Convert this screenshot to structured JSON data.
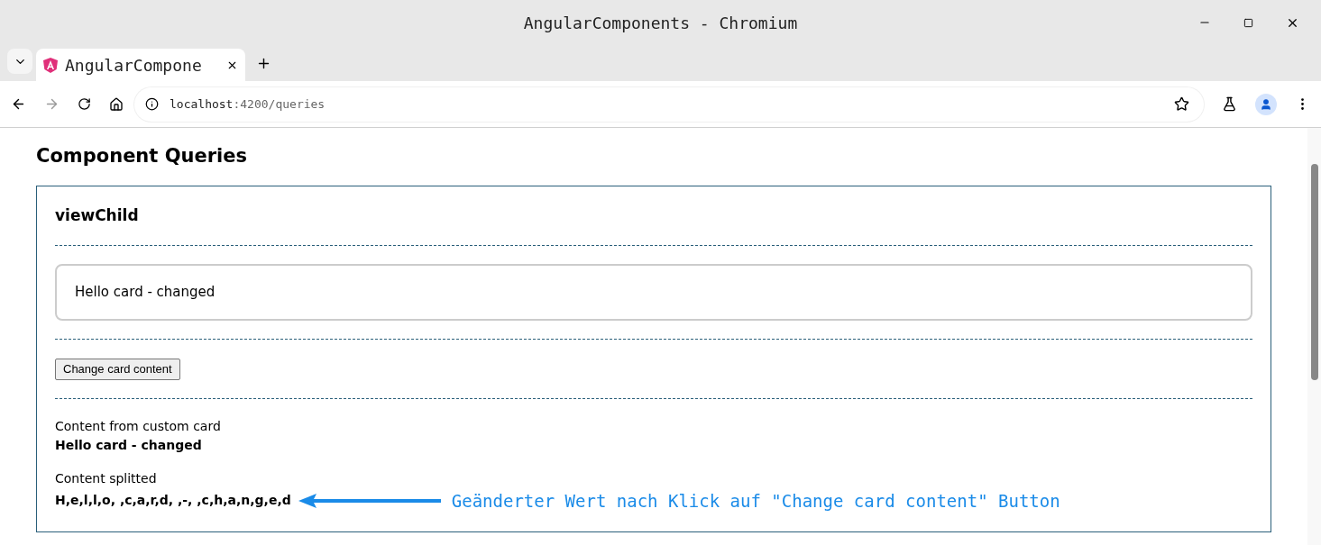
{
  "window": {
    "title": "AngularComponents - Chromium"
  },
  "tabs": [
    {
      "label": "AngularCompone",
      "selected": true
    }
  ],
  "address_bar": {
    "host": "localhost",
    "path": ":4200/queries"
  },
  "page": {
    "heading": "Component Queries",
    "section_title": "viewChild",
    "card_text": "Hello card - changed",
    "button": "Change card content",
    "content_label": "Content from custom card",
    "content_value": "Hello card - changed",
    "split_label": "Content splitted",
    "split_value": "H,e,l,l,o, ,c,a,r,d, ,-, ,c,h,a,n,g,e,d",
    "annotation": "Geänderter Wert nach Klick auf \"Change card content\" Button"
  }
}
